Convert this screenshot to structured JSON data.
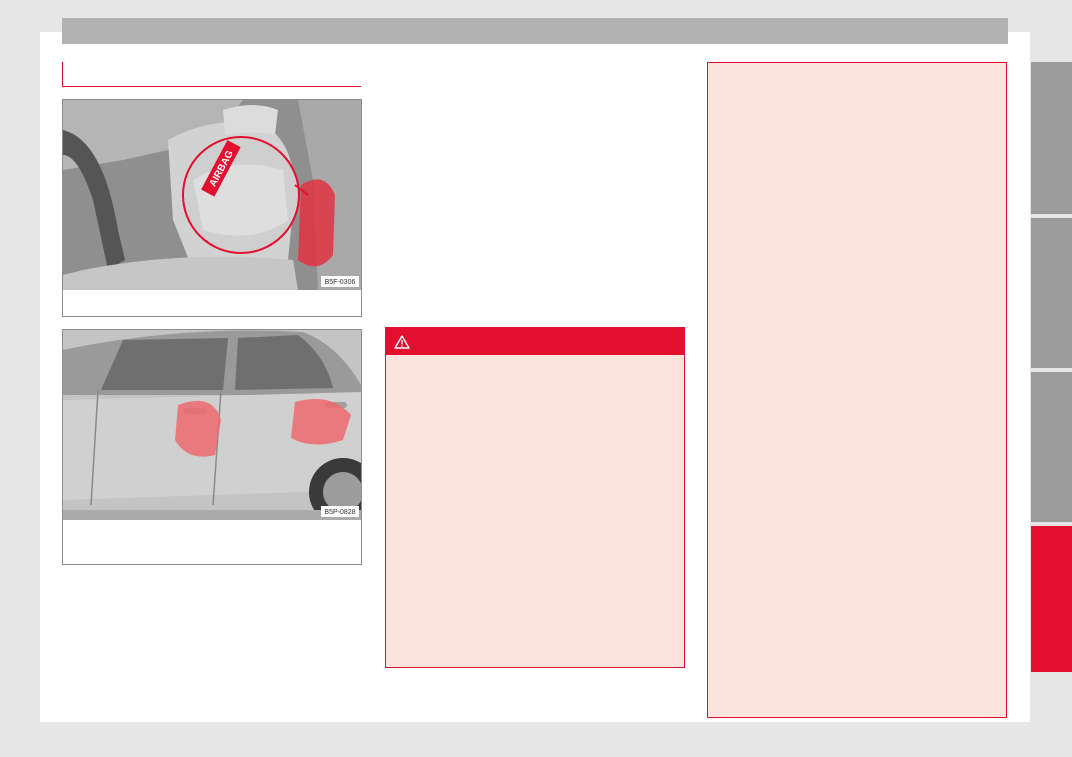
{
  "figures": [
    {
      "code": "B5F-0306",
      "badge_text": "AIRBAG",
      "caption": ""
    },
    {
      "code": "B5P-0828",
      "caption": ""
    }
  ],
  "warning": {
    "icon": "warning-triangle-icon"
  },
  "colors": {
    "accent": "#e30f2f",
    "panel_bg": "#fbe3de",
    "tab_inactive": "#9b9b9b",
    "tab_active": "#e30f2f"
  },
  "tabs": [
    {
      "id": "tab-1",
      "active": false
    },
    {
      "id": "tab-2",
      "active": false
    },
    {
      "id": "tab-3",
      "active": false
    },
    {
      "id": "tab-4",
      "active": true
    }
  ]
}
